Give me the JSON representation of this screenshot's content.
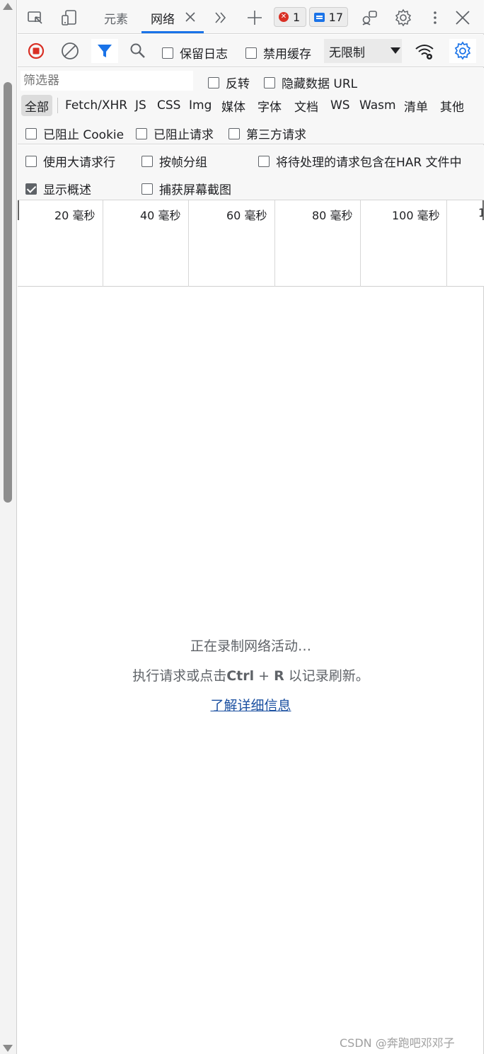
{
  "tabs": {
    "elements": "元素",
    "network": "网络"
  },
  "badges": {
    "errors": "1",
    "messages": "17"
  },
  "toolbar": {
    "preserve_log": "保留日志",
    "disable_cache": "禁用缓存",
    "throttling": "无限制"
  },
  "filter": {
    "placeholder": "筛选器",
    "invert": "反转",
    "hide_data_urls": "隐藏数据 URL",
    "types": [
      "全部",
      "Fetch/XHR",
      "JS",
      "CSS",
      "Img",
      "媒体",
      "字体",
      "文档",
      "WS",
      "Wasm",
      "清单",
      "其他"
    ],
    "blocked_cookies": "已阻止 Cookie",
    "blocked_requests": "已阻止请求",
    "third_party": "第三方请求"
  },
  "settings": {
    "big_rows": "使用大请求行",
    "group_by_frame": "按帧分组",
    "include_pending": "将待处理的请求包含在HAR 文件中",
    "show_overview": "显示概述",
    "capture_screenshots": "捕获屏幕截图",
    "show_overview_checked": true
  },
  "timeline": {
    "labels": [
      "20  毫秒",
      "40  毫秒",
      "60  毫秒",
      "80  毫秒",
      "100  毫秒",
      "1"
    ]
  },
  "empty": {
    "recording": "正在录制网络活动…",
    "hint_prefix": "执行请求或点击",
    "hint_shortcut_ctrl": "Ctrl",
    "hint_plus": " + ",
    "hint_shortcut_r": "R",
    "hint_suffix": " 以记录刷新。",
    "learn_more": "了解详细信息"
  },
  "watermark": "CSDN @奔跑吧邓邓子",
  "colors": {
    "accent": "#1a73e8",
    "record_red": "#d93025",
    "link": "#1a4fa0"
  }
}
